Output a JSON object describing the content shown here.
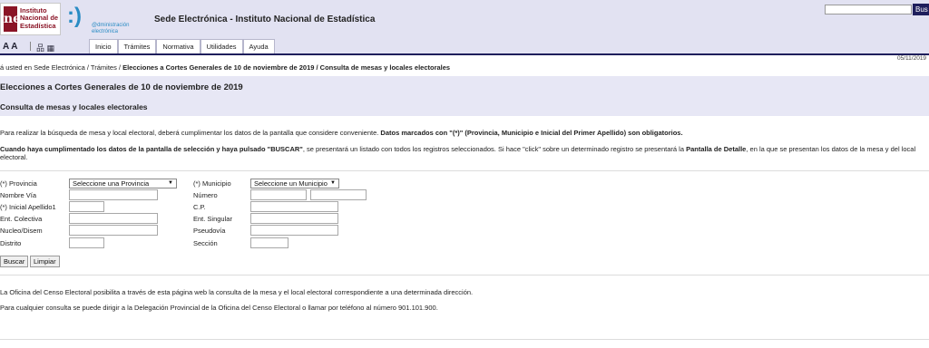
{
  "header": {
    "logo_letters": "ne",
    "logo_text": "Instituto Nacional de Estadística",
    "de_symbol": ":)",
    "de_text": "@dministración electrónica",
    "site_title": "Sede Electrónica - Instituto Nacional de Estadística",
    "search_button": "Bus",
    "font_controls": "A A",
    "sitemap_icon_glyph": "品 ▦"
  },
  "tabs": [
    "Inicio",
    "Trámites",
    "Normativa",
    "Utilidades",
    "Ayuda"
  ],
  "date": "05/11/2019",
  "breadcrumb": {
    "prefix": "á usted en Sede Electrónica / Trámites / ",
    "bold": "Elecciones a Cortes Generales de 10 de noviembre de 2019 / Consulta de mesas y locales electorales"
  },
  "page_title": "Elecciones a Cortes Generales de 10 de noviembre de 2019",
  "sub_title": "Consulta de mesas y locales electorales",
  "intro1": {
    "text": "Para realizar la búsqueda de mesa y local electoral, deberá cumplimentar los datos de la pantalla que considere conveniente. ",
    "bold": "Datos marcados con \"(*)\" (Provincia, Municipio e Inicial del Primer Apellido) son obligatorios."
  },
  "intro2": {
    "bold1": "Cuando haya cumplimentado los datos de la pantalla de selección y haya pulsado \"BUSCAR\"",
    "text1": ", se presentará un listado con todos los registros seleccionados. Si hace \"click\" sobre un determinado registro se presentará la ",
    "bold2": "Pantalla de Detalle",
    "text2": ", en la que se presentan los datos de la mesa y del local electoral."
  },
  "form": {
    "provincia_label": "(*) Provincia",
    "provincia_value": "Seleccione una Provincia",
    "municipio_label": "(*) Municipio",
    "municipio_value": "Seleccione un Municipio",
    "nombre_via_label": "Nombre Vía",
    "numero_label": "Número",
    "inicial_label": "(*) Inicial Apellido1",
    "cp_label": "C.P.",
    "ent_colectiva_label": "Ent. Colectiva",
    "ent_singular_label": "Ent. Singular",
    "nucleo_label": "Nucleo/Disem",
    "pseudovia_label": "Pseudovía",
    "distrito_label": "Distrito",
    "seccion_label": "Sección",
    "buscar": "Buscar",
    "limpiar": "Limpiar"
  },
  "footer": {
    "line1": "La Oficina del Censo Electoral posibilita a través de esta página web la consulta de la mesa y el local electoral correspondiente a una determinada dirección.",
    "line2": "Para cualquier consulta se puede dirigir a la Delegación Provincial de la Oficina del Censo Electoral o llamar por teléfono al número 901.101.900."
  },
  "colors": {
    "header_bg": "#e2e2f2",
    "brand_red": "#8a1426",
    "navy": "#1e1e5c",
    "title_band": "#e7e7f5"
  }
}
